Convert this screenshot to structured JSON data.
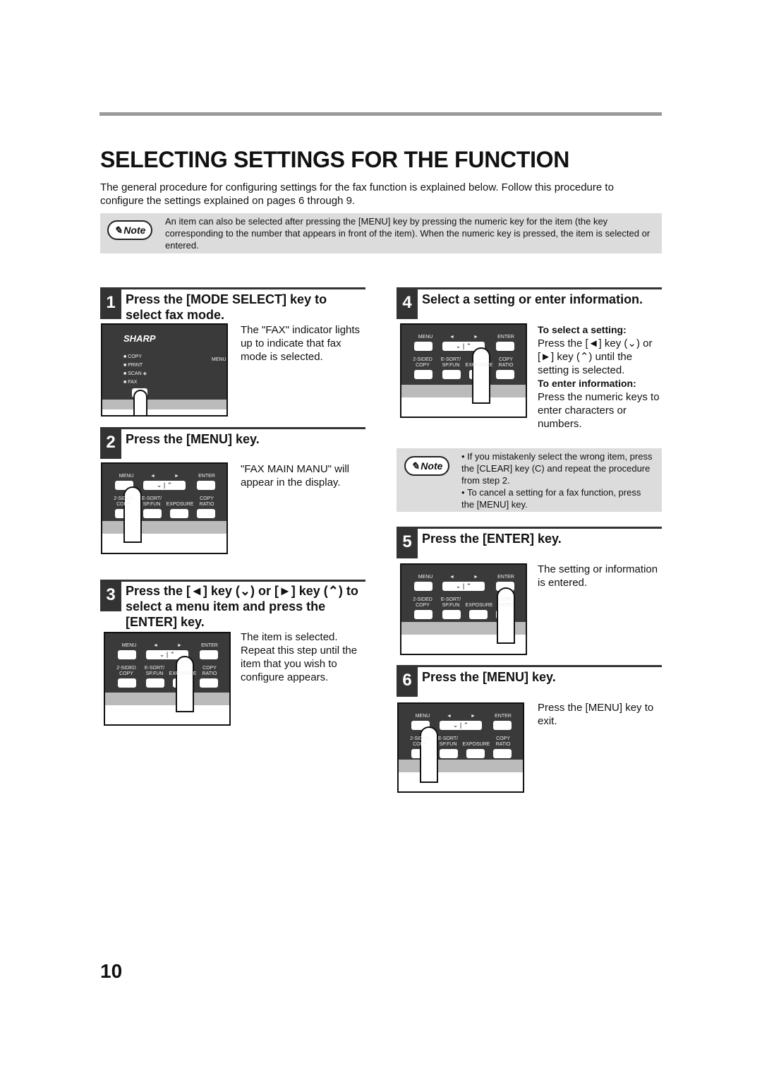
{
  "title": "SELECTING SETTINGS FOR THE FUNCTION",
  "intro": "The general procedure for configuring settings for the fax function is explained below. Follow this procedure to configure the settings explained on pages 6 through 9.",
  "note_label": "Note",
  "note1": "An item can also be selected after pressing the [MENU] key by pressing the numeric key for the item (the key corresponding to the number that appears in front of the item). When the numeric key is pressed, the item is selected or entered.",
  "panel": {
    "brand": "SHARP",
    "copy": "COPY",
    "print": "PRINT",
    "scan": "SCAN",
    "fax": "FAX",
    "menu": "MENU",
    "left": "◄",
    "right": "►",
    "enter": "ENTER",
    "sided": "2-SIDED",
    "copy2": "COPY",
    "esort": "E-SORT/",
    "spfun": "SP.FUN",
    "exposure": "EXPOSURE",
    "copyr": "COPY",
    "ratio": "RATIO"
  },
  "steps": [
    {
      "num": "1",
      "heading": "Press the [MODE SELECT] key to select fax mode.",
      "text": "The \"FAX\" indicator lights up to indicate that fax mode is selected."
    },
    {
      "num": "2",
      "heading": "Press the [MENU] key.",
      "text": "\"FAX MAIN MANU\" will appear in the display."
    },
    {
      "num": "3",
      "heading": "Press the [◄] key (⌄) or [►] key (⌃) to select a menu item and press the [ENTER] key.",
      "text": "The item is selected. Repeat this step until the item that you wish to configure appears."
    },
    {
      "num": "4",
      "heading": "Select a setting or enter information.",
      "sub1": "To select a setting:",
      "text1": "Press the [◄] key (⌄) or [►] key (⌃) until the setting is selected.",
      "sub2": "To enter information:",
      "text2": "Press the numeric keys to enter characters or numbers."
    },
    {
      "num": "5",
      "heading": "Press the [ENTER] key.",
      "text": "The setting or information is entered."
    },
    {
      "num": "6",
      "heading": "Press the [MENU] key.",
      "text": "Press the [MENU] key to exit."
    }
  ],
  "note2": [
    "If you mistakenly select the wrong item, press the [CLEAR] key (C) and repeat the procedure from step 2.",
    "To cancel a setting for a fax function, press the [MENU] key."
  ],
  "page_number": "10"
}
